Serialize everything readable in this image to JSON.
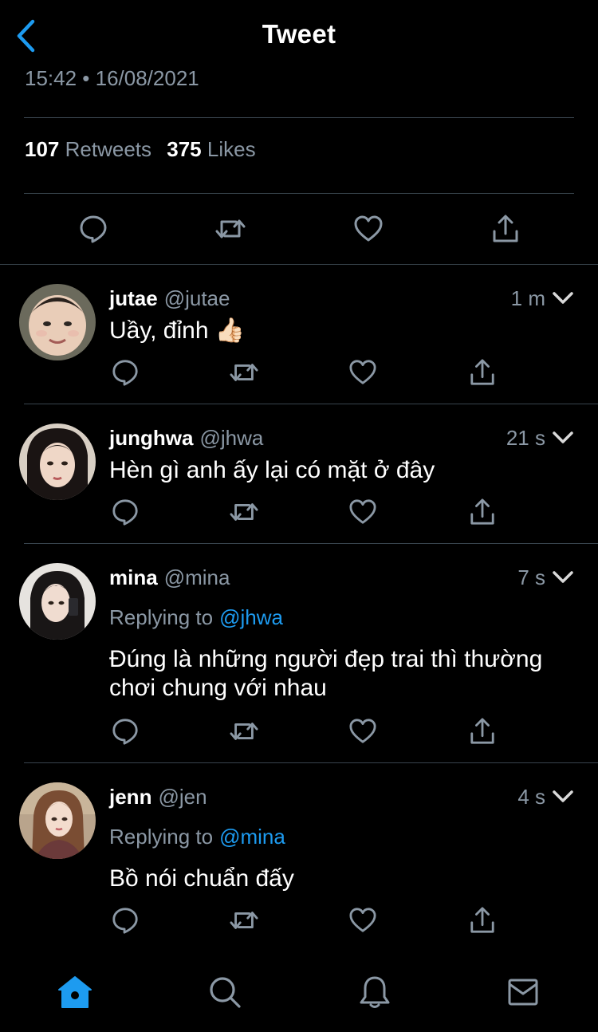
{
  "header": {
    "title": "Tweet",
    "timestamp": "15:42 • 16/08/2021"
  },
  "stats": {
    "retweets_count": "107",
    "retweets_label": "Retweets",
    "likes_count": "375",
    "likes_label": "Likes"
  },
  "colors": {
    "background": "#000000",
    "accent": "#1d9bf0",
    "muted_text": "#8b98a5",
    "divider": "#38444d"
  },
  "replies": [
    {
      "name": "jutae",
      "handle": "@jutae",
      "time": "1 m",
      "replying_label": "",
      "replying_to": "",
      "text": "Uầy, đỉnh 👍🏻"
    },
    {
      "name": "junghwa",
      "handle": "@jhwa",
      "time": "21 s",
      "replying_label": "",
      "replying_to": "",
      "text": "Hèn gì anh ấy lại có mặt ở đây"
    },
    {
      "name": "mina",
      "handle": "@mina",
      "time": "7 s",
      "replying_label": "Replying to",
      "replying_to": "@jhwa",
      "text": "Đúng là những người đẹp trai thì thường chơi chung với nhau"
    },
    {
      "name": "jenn",
      "handle": "@jen",
      "time": "4 s",
      "replying_label": "Replying to",
      "replying_to": "@mina",
      "text": "Bồ nói chuẩn đấy"
    }
  ],
  "icons": {
    "back": "chevron-left-icon",
    "reply": "reply-icon",
    "retweet": "retweet-icon",
    "like": "heart-icon",
    "share": "share-icon",
    "more": "chevron-down-icon",
    "tab_home": "home-icon",
    "tab_search": "search-icon",
    "tab_notifications": "bell-icon",
    "tab_messages": "mail-icon"
  }
}
